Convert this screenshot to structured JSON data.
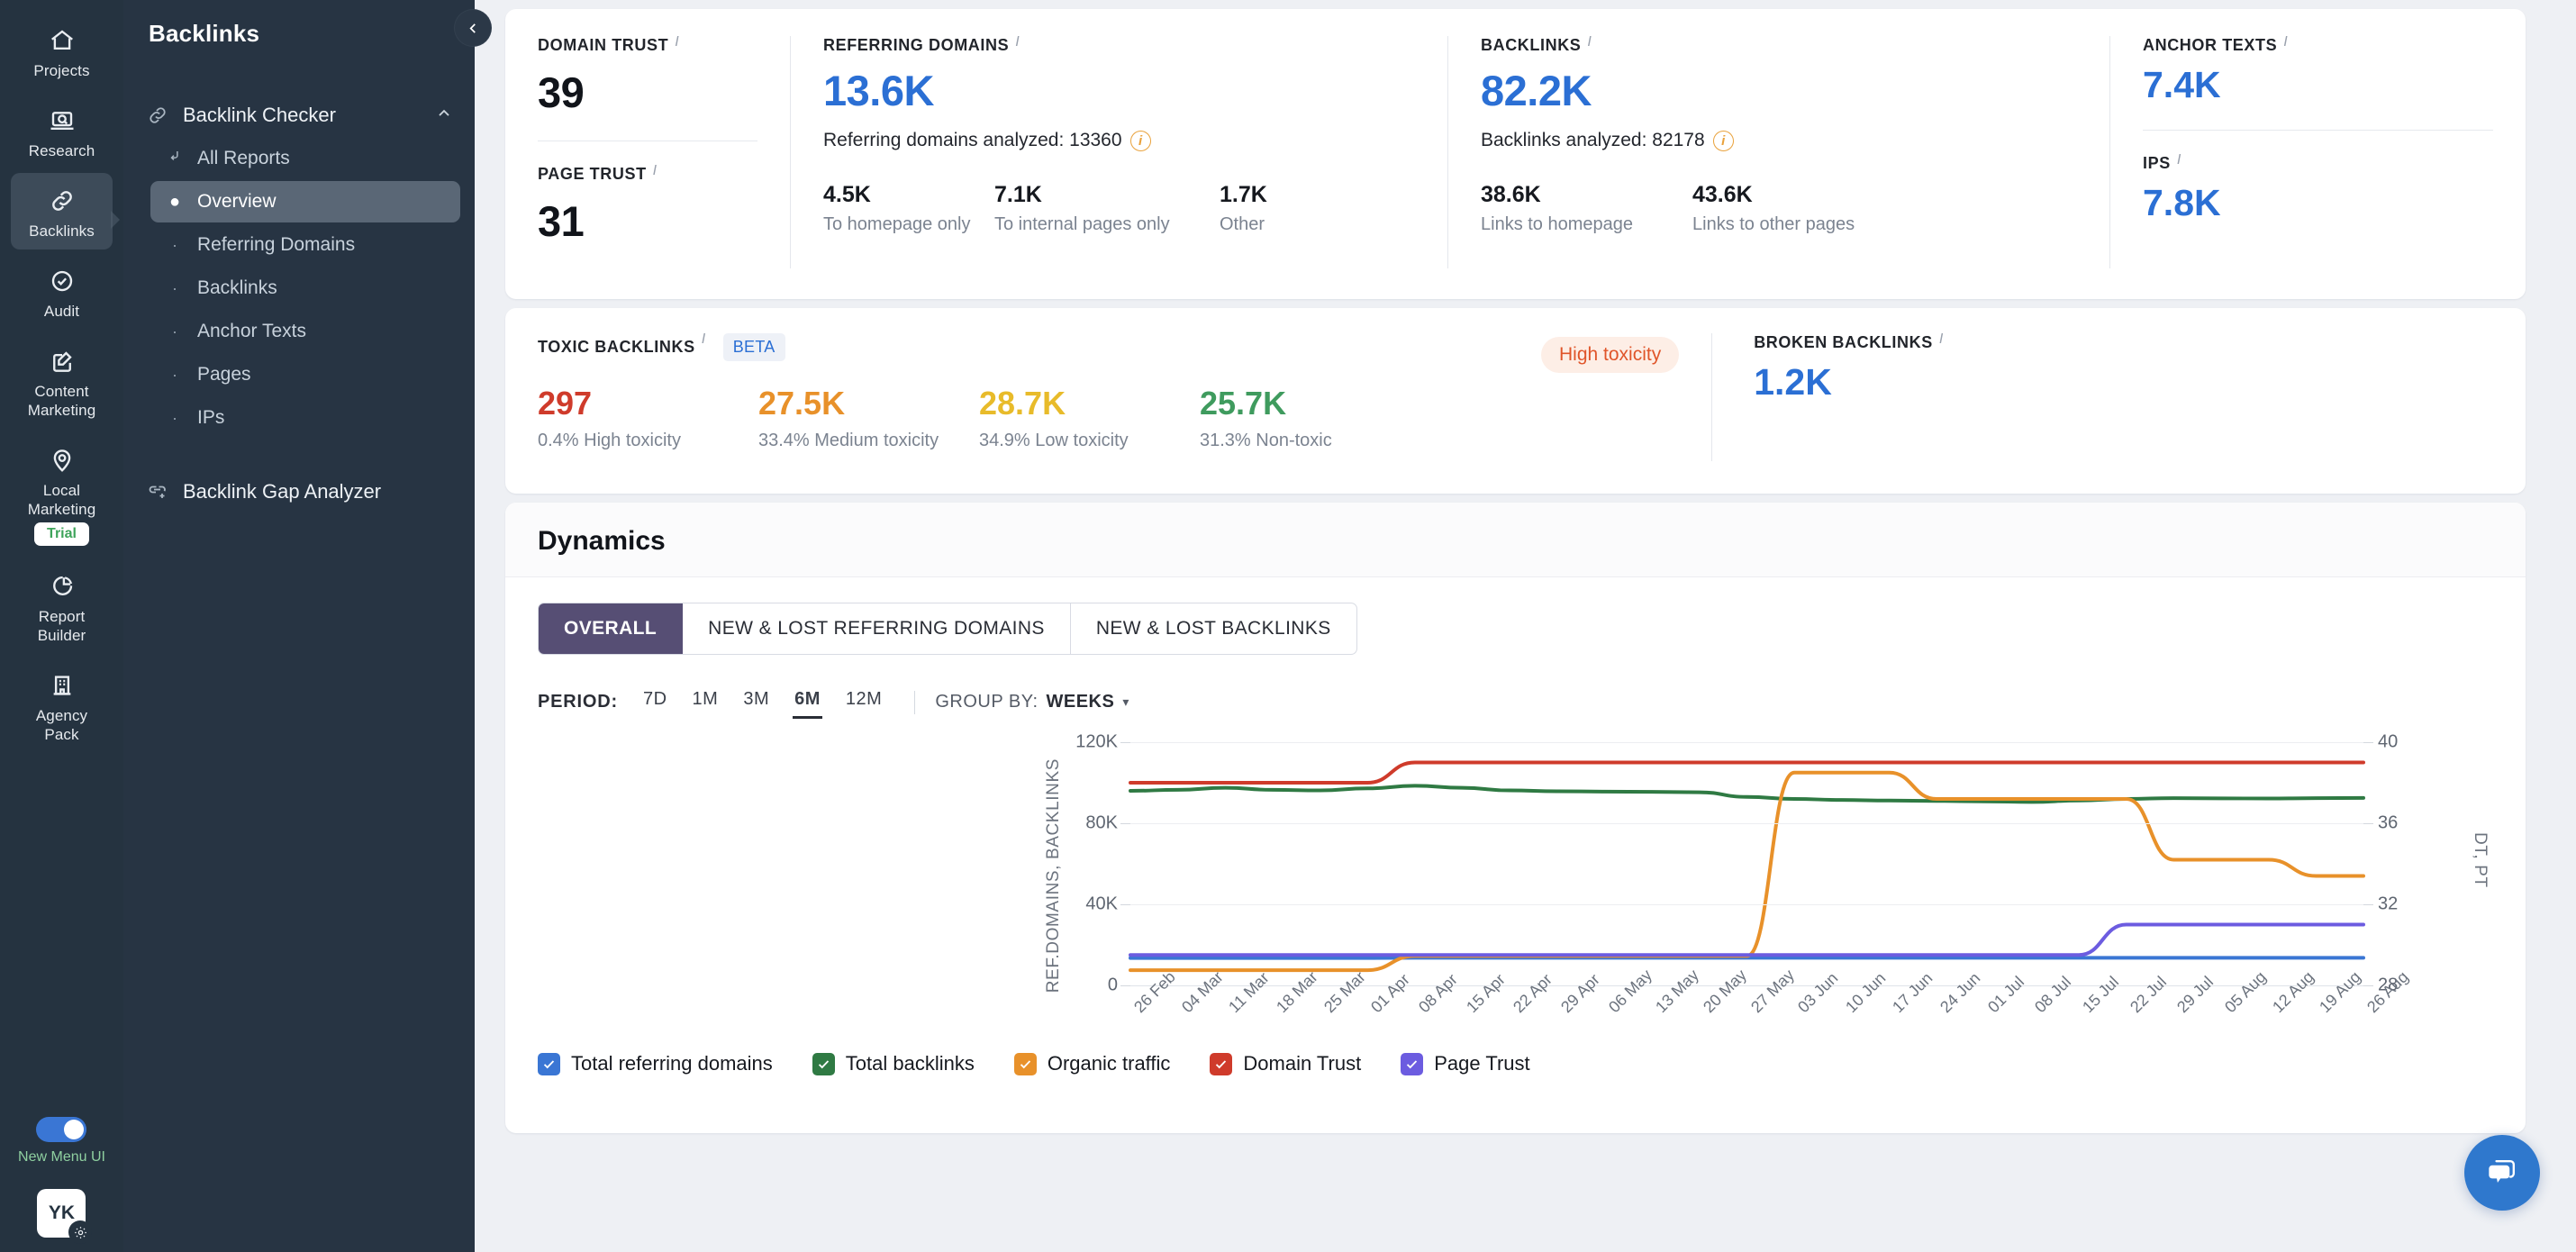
{
  "rail": {
    "items": [
      {
        "label": "Projects",
        "icon": "home-icon",
        "active": false
      },
      {
        "label": "Research",
        "icon": "research-icon",
        "active": false
      },
      {
        "label": "Backlinks",
        "icon": "link-icon",
        "active": true
      },
      {
        "label": "Audit",
        "icon": "check-circle-icon",
        "active": false
      },
      {
        "label": "Content\nMarketing",
        "icon": "edit-square-icon",
        "active": false
      },
      {
        "label": "Local\nMarketing",
        "icon": "map-pin-icon",
        "active": false,
        "badge": "Trial"
      },
      {
        "label": "Report\nBuilder",
        "icon": "pie-chart-icon",
        "active": false
      },
      {
        "label": "Agency\nPack",
        "icon": "building-icon",
        "active": false
      }
    ],
    "toggle_label": "New Menu UI",
    "avatar_initials": "YK"
  },
  "subnav": {
    "title": "Backlinks",
    "group": {
      "label": "Backlink Checker",
      "icon": "link-icon"
    },
    "items": [
      {
        "label": "All Reports",
        "marker": "arrow",
        "active": false
      },
      {
        "label": "Overview",
        "marker": "dot",
        "active": true
      },
      {
        "label": "Referring Domains",
        "marker": "dot-sm",
        "active": false
      },
      {
        "label": "Backlinks",
        "marker": "dot-sm",
        "active": false
      },
      {
        "label": "Anchor Texts",
        "marker": "dot-sm",
        "active": false
      },
      {
        "label": "Pages",
        "marker": "dot-sm",
        "active": false
      },
      {
        "label": "IPs",
        "marker": "dot-sm",
        "active": false
      }
    ],
    "gap_analyzer": "Backlink Gap Analyzer"
  },
  "kpi": {
    "domain_trust": {
      "label": "DOMAIN TRUST",
      "value": "39"
    },
    "page_trust": {
      "label": "PAGE TRUST",
      "value": "31"
    },
    "referring_domains": {
      "label": "REFERRING DOMAINS",
      "value": "13.6K",
      "analyzed": "Referring domains analyzed: 13360",
      "breakdown": [
        {
          "value": "4.5K",
          "text": "To homepage only"
        },
        {
          "value": "7.1K",
          "text": "To internal pages only"
        },
        {
          "value": "1.7K",
          "text": "Other"
        }
      ]
    },
    "backlinks": {
      "label": "BACKLINKS",
      "value": "82.2K",
      "analyzed": "Backlinks analyzed: 82178",
      "breakdown": [
        {
          "value": "38.6K",
          "text": "Links to homepage"
        },
        {
          "value": "43.6K",
          "text": "Links to other pages"
        }
      ]
    },
    "anchor_texts": {
      "label": "ANCHOR TEXTS",
      "value": "7.4K"
    },
    "ips": {
      "label": "IPS",
      "value": "7.8K"
    }
  },
  "toxic": {
    "label": "TOXIC BACKLINKS",
    "beta": "BETA",
    "badge": "High toxicity",
    "stats": [
      {
        "value": "297",
        "text": "0.4% High toxicity",
        "color": "#cf3b2b"
      },
      {
        "value": "27.5K",
        "text": "33.4% Medium toxicity",
        "color": "#e8912a"
      },
      {
        "value": "28.7K",
        "text": "34.9% Low toxicity",
        "color": "#e8bb2a"
      },
      {
        "value": "25.7K",
        "text": "31.3% Non-toxic",
        "color": "#3f9b5e"
      }
    ],
    "broken": {
      "label": "BROKEN BACKLINKS",
      "value": "1.2K"
    }
  },
  "dynamics": {
    "title": "Dynamics",
    "tabs": [
      {
        "label": "OVERALL",
        "active": true
      },
      {
        "label": "NEW & LOST REFERRING DOMAINS",
        "active": false
      },
      {
        "label": "NEW & LOST BACKLINKS",
        "active": false
      }
    ],
    "period_label": "PERIOD:",
    "periods": [
      {
        "label": "7D",
        "active": false
      },
      {
        "label": "1M",
        "active": false
      },
      {
        "label": "3M",
        "active": false
      },
      {
        "label": "6M",
        "active": true
      },
      {
        "label": "12M",
        "active": false
      }
    ],
    "group_by_label": "GROUP BY:",
    "group_by_value": "WEEKS",
    "chevron": "chevron-down-icon"
  },
  "chart_data": {
    "type": "line",
    "title": "Dynamics",
    "ylabel": "REF.DOMAINS, BACKLINKS",
    "ylabel_right": "DT, PT",
    "xlabel": "",
    "ylim": [
      0,
      120000
    ],
    "yticks": [
      "0",
      "40K",
      "80K",
      "120K"
    ],
    "ylim_right": [
      28,
      40
    ],
    "yticks_right": [
      "28",
      "32",
      "36",
      "40"
    ],
    "grid": true,
    "legend_position": "bottom",
    "x": [
      "26 Feb",
      "04 Mar",
      "11 Mar",
      "18 Mar",
      "25 Mar",
      "01 Apr",
      "08 Apr",
      "15 Apr",
      "22 Apr",
      "29 Apr",
      "06 May",
      "13 May",
      "20 May",
      "27 May",
      "03 Jun",
      "10 Jun",
      "17 Jun",
      "24 Jun",
      "01 Jul",
      "08 Jul",
      "15 Jul",
      "22 Jul",
      "29 Jul",
      "05 Aug",
      "12 Aug",
      "19 Aug",
      "26 Aug"
    ],
    "series": [
      {
        "name": "Total referring domains",
        "color": "#3a76d4",
        "axis": "left",
        "values": [
          13500,
          13500,
          13500,
          13500,
          13500,
          13500,
          13600,
          13600,
          13600,
          13600,
          13600,
          13600,
          13600,
          13600,
          13600,
          13600,
          13600,
          13600,
          13600,
          13600,
          13600,
          13600,
          13600,
          13600,
          13600,
          13600,
          13600
        ]
      },
      {
        "name": "Total backlinks",
        "color": "#2f7a43",
        "axis": "left",
        "values": [
          96000,
          96500,
          97500,
          96500,
          96200,
          97200,
          98500,
          97500,
          96200,
          95800,
          95600,
          95500,
          95300,
          93000,
          92000,
          91500,
          91200,
          91000,
          90800,
          90500,
          91200,
          92000,
          92400,
          92300,
          92200,
          92400,
          92500
        ]
      },
      {
        "name": "Organic traffic",
        "color": "#e8912a",
        "axis": "left",
        "values": [
          7500,
          7500,
          7500,
          7500,
          7500,
          7500,
          14500,
          14500,
          14500,
          14500,
          14500,
          14500,
          14500,
          14500,
          105000,
          105000,
          105000,
          92000,
          92000,
          92000,
          92000,
          92000,
          62000,
          62000,
          62000,
          54000,
          54000
        ]
      },
      {
        "name": "Domain Trust",
        "color": "#cf3b2b",
        "axis": "right",
        "values": [
          38,
          38,
          38,
          38,
          38,
          38,
          39,
          39,
          39,
          39,
          39,
          39,
          39,
          39,
          39,
          39,
          39,
          39,
          39,
          39,
          39,
          39,
          39,
          39,
          39,
          39,
          39
        ]
      },
      {
        "name": "Page Trust",
        "color": "#6c5ce0",
        "axis": "right",
        "values": [
          29.5,
          29.5,
          29.5,
          29.5,
          29.5,
          29.5,
          29.5,
          29.5,
          29.5,
          29.5,
          29.5,
          29.5,
          29.5,
          29.5,
          29.5,
          29.5,
          29.5,
          29.5,
          29.5,
          29.5,
          29.5,
          31,
          31,
          31,
          31,
          31,
          31
        ]
      }
    ]
  },
  "legend": [
    {
      "label": "Total referring domains",
      "color": "#3a76d4",
      "checked": true
    },
    {
      "label": "Total backlinks",
      "color": "#2f7a43",
      "checked": true
    },
    {
      "label": "Organic traffic",
      "color": "#e8912a",
      "checked": true
    },
    {
      "label": "Domain Trust",
      "color": "#cf3b2b",
      "checked": true
    },
    {
      "label": "Page Trust",
      "color": "#6c5ce0",
      "checked": true
    }
  ],
  "chat": {
    "icon": "chat-bubble-icon"
  }
}
